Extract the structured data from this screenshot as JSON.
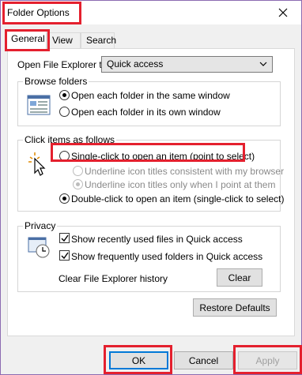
{
  "window": {
    "title": "Folder Options"
  },
  "tabs": [
    {
      "label": "General"
    },
    {
      "label": "View"
    },
    {
      "label": "Search"
    }
  ],
  "open_explorer": {
    "label": "Open File Explorer to:",
    "value": "Quick access"
  },
  "browse": {
    "title": "Browse folders",
    "options": [
      {
        "label": "Open each folder in the same window",
        "checked": true
      },
      {
        "label": "Open each folder in its own window",
        "checked": false
      }
    ]
  },
  "click": {
    "title": "Click items as follows",
    "single": "Single-click to open an item (point to select)",
    "sub1": "Underline icon titles consistent with my browser",
    "sub2": "Underline icon titles only when I point at them",
    "double": "Double-click to open an item (single-click to select)"
  },
  "privacy": {
    "title": "Privacy",
    "recent": "Show recently used files in Quick access",
    "frequent": "Show frequently used folders in Quick access",
    "clear_label": "Clear File Explorer history",
    "clear_button": "Clear"
  },
  "restore_button": "Restore Defaults",
  "buttons": {
    "ok": "OK",
    "cancel": "Cancel",
    "apply": "Apply"
  },
  "colors": {
    "highlight": "#e4202e",
    "accent": "#0078d7"
  }
}
